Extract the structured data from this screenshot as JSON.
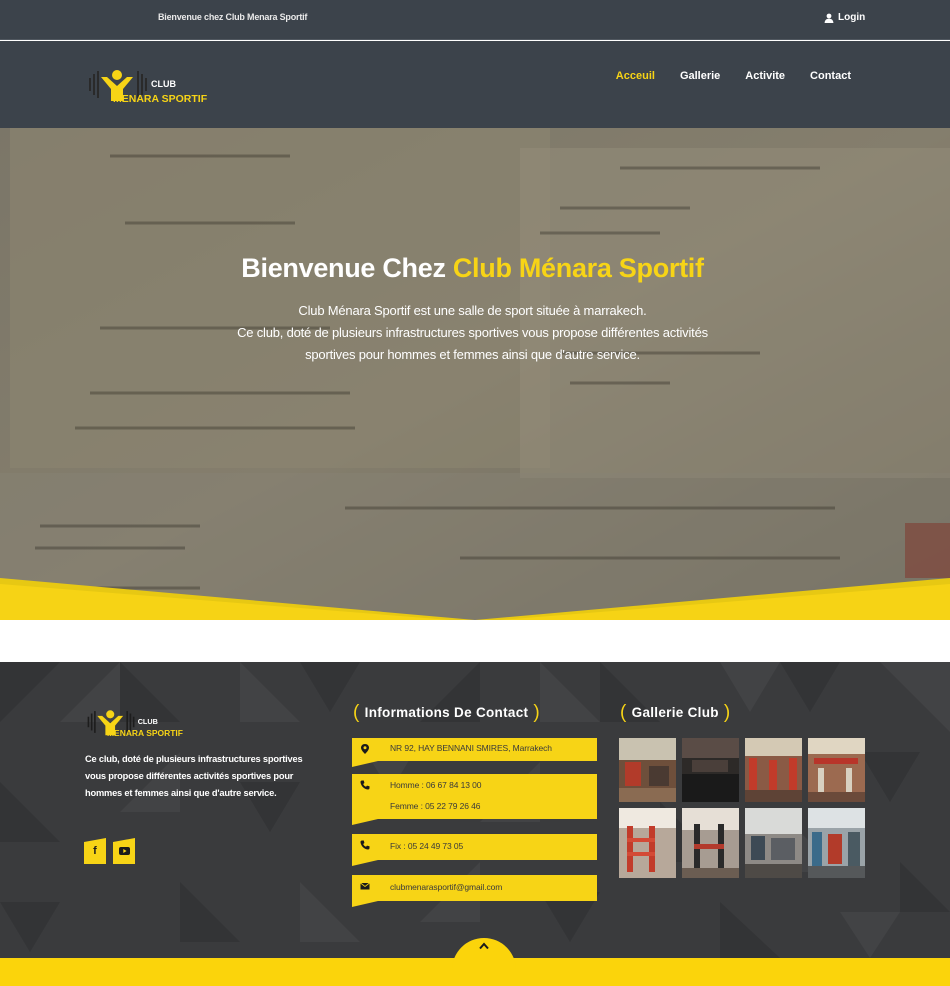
{
  "topbar": {
    "welcome": "Bienvenue chez Club Menara Sportif",
    "login": "Login"
  },
  "logo": {
    "club": "CLUB",
    "name": "MENARA SPORTIF"
  },
  "nav": {
    "items": [
      {
        "label": "Acceuil",
        "active": true
      },
      {
        "label": "Gallerie",
        "active": false
      },
      {
        "label": "Activite",
        "active": false
      },
      {
        "label": "Contact",
        "active": false
      }
    ]
  },
  "hero": {
    "title_prefix": "Bienvenue Chez ",
    "title_accent": "Club Ménara Sportif",
    "line1": "Club Ménara Sportif est une salle de sport située à marrakech.",
    "line2": "Ce club, doté de plusieurs infrastructures sportives vous propose différentes activités",
    "line3": "sportives pour hommes et femmes ainsi que d'autre service."
  },
  "footer": {
    "description": "Ce club, doté de plusieurs infrastructures sportives vous propose différentes activités sportives pour hommes et femmes ainsi que d'autre service.",
    "contact_title": "Informations De Contact",
    "address": "NR 92, HAY BENNANI SMIRES, Marrakech",
    "phone_home": "Homme : 06 67 84 13 00",
    "phone_femme": "Femme : 05 22 79 26 46",
    "fix": "Fix : 05 24 49 73 05",
    "email": "clubmenarasportif@gmail.com",
    "gallery_title": "Gallerie Club"
  },
  "colors": {
    "accent": "#f7d416",
    "header_bg": "#3c434b",
    "footer_bg": "#3a3b3d"
  },
  "icons": {
    "login": "user-icon",
    "address": "map-marker-icon",
    "phone": "phone-icon",
    "email": "envelope-icon",
    "facebook": "facebook-icon",
    "youtube": "youtube-icon",
    "back_to_top": "chevron-up-icon"
  }
}
